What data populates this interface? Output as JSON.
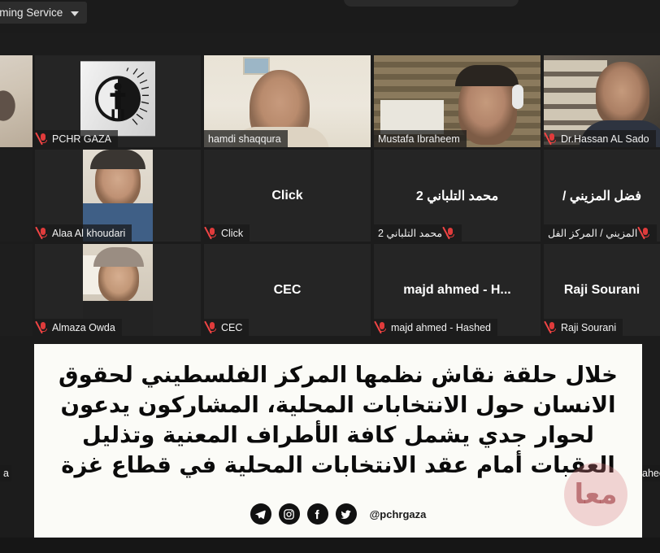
{
  "window": {
    "background_color": "#1b1b1b",
    "active_speaker_border_color": "#c7e33a"
  },
  "topbar": {
    "stream_chip_label": "treaming Service",
    "stream_chip_caret": "chevron-down-icon"
  },
  "grid": {
    "rows": 3,
    "columns": 4,
    "participants": [
      {
        "id": "p0",
        "name": "",
        "badge": "",
        "has_video": true,
        "muted": false,
        "active": false,
        "rtl": false,
        "kind": "video-partial"
      },
      {
        "id": "p1",
        "name": "PCHR GAZA",
        "badge": "PCHR GAZA",
        "has_video": false,
        "muted": true,
        "active": false,
        "rtl": false,
        "kind": "logo"
      },
      {
        "id": "p2",
        "name": "hamdi shaqqura",
        "badge": "hamdi shaqqura",
        "has_video": true,
        "muted": false,
        "active": false,
        "rtl": false,
        "kind": "video"
      },
      {
        "id": "p3",
        "name": "Mustafa Ibraheem",
        "badge": "Mustafa Ibraheem",
        "has_video": true,
        "muted": false,
        "active": true,
        "rtl": false,
        "kind": "video"
      },
      {
        "id": "p4",
        "name": "Dr.Hassan AL Sado",
        "badge": "Dr.Hassan AL Sado",
        "has_video": true,
        "muted": true,
        "active": false,
        "rtl": false,
        "kind": "video"
      },
      {
        "id": "p5",
        "name": "",
        "badge": "",
        "has_video": false,
        "muted": false,
        "active": false,
        "rtl": false,
        "kind": "blank"
      },
      {
        "id": "p6",
        "name": "Alaa Al khoudari",
        "badge": "Alaa Al khoudari",
        "has_video": true,
        "muted": true,
        "active": false,
        "rtl": false,
        "kind": "video"
      },
      {
        "id": "p7",
        "name": "Click",
        "badge": "Click",
        "has_video": false,
        "muted": true,
        "active": false,
        "rtl": false,
        "kind": "name"
      },
      {
        "id": "p8",
        "name": "محمد التلباني 2",
        "badge": "محمد التلباني 2",
        "has_video": false,
        "muted": true,
        "active": false,
        "rtl": true,
        "kind": "name"
      },
      {
        "id": "p9",
        "name": "فضل المزيني /",
        "badge": "المزيني / المركز الفل",
        "has_video": false,
        "muted": true,
        "active": false,
        "rtl": true,
        "kind": "name"
      },
      {
        "id": "p10",
        "name": "",
        "badge": "",
        "has_video": false,
        "muted": false,
        "active": false,
        "rtl": false,
        "kind": "blank"
      },
      {
        "id": "p11",
        "name": "Almaza Owda",
        "badge": "Almaza Owda",
        "has_video": true,
        "muted": true,
        "active": false,
        "rtl": false,
        "kind": "video"
      },
      {
        "id": "p12",
        "name": "CEC",
        "badge": "CEC",
        "has_video": false,
        "muted": true,
        "active": false,
        "rtl": false,
        "kind": "name"
      },
      {
        "id": "p13",
        "name": "majd ahmed - H...",
        "badge": "majd ahmed - Hashed",
        "has_video": false,
        "muted": true,
        "active": false,
        "rtl": false,
        "kind": "name"
      },
      {
        "id": "p14",
        "name": "Raji Sourani",
        "badge": "Raji Sourani",
        "has_video": false,
        "muted": true,
        "active": false,
        "rtl": false,
        "kind": "name"
      }
    ],
    "edge_labels": {
      "left_partial": "a",
      "right_partial": "ahee"
    }
  },
  "caption": {
    "background_color": "#fbfbf7",
    "line1": "خلال حلقة نقاش نظمها المركز الفلسطيني لحقوق",
    "line2": "الانسان حول الانتخابات المحلية، المشاركون يدعون",
    "line3": "لحوار جدي يشمل كافة الأطراف المعنية وتذليل",
    "line4": "العقبات أمام عقد الانتخابات المحلية في قطاع غزة",
    "handle": "@pchrgaza",
    "socials": [
      {
        "icon": "telegram-icon"
      },
      {
        "icon": "instagram-icon"
      },
      {
        "icon": "facebook-icon"
      },
      {
        "icon": "twitter-icon"
      }
    ],
    "watermark_text": "معا",
    "watermark_color": "#d6787d"
  }
}
